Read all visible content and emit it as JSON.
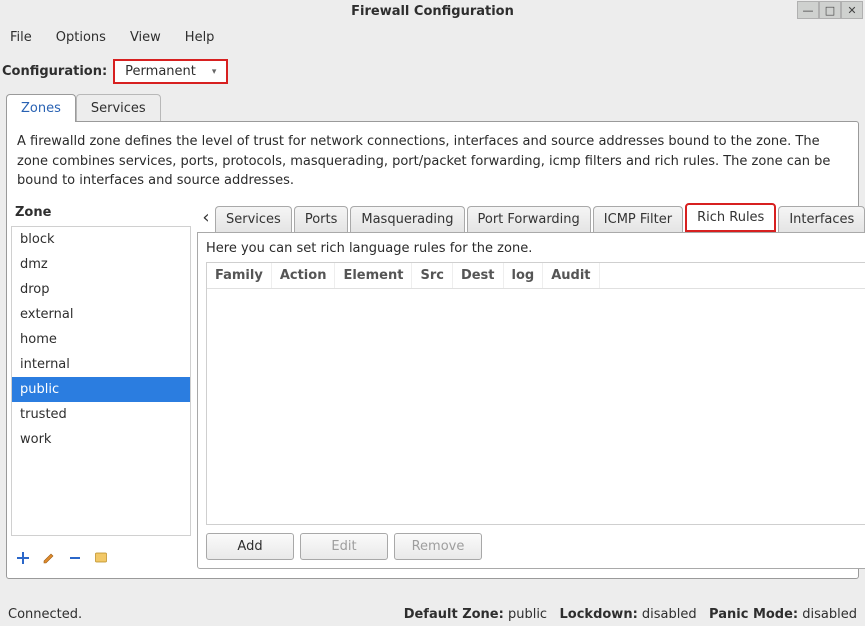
{
  "title": "Firewall Configuration",
  "menu": [
    "File",
    "Options",
    "View",
    "Help"
  ],
  "config": {
    "label": "Configuration:",
    "value": "Permanent"
  },
  "mainTabs": {
    "zones": "Zones",
    "services": "Services"
  },
  "zoneDesc": "A firewalld zone defines the level of trust for network connections, interfaces and source addresses bound to the zone. The zone combines services, ports, protocols, masquerading, port/packet forwarding, icmp filters and rich rules. The zone can be bound to interfaces and source addresses.",
  "zoneLabel": "Zone",
  "zones": [
    "block",
    "dmz",
    "drop",
    "external",
    "home",
    "internal",
    "public",
    "trusted",
    "work"
  ],
  "selectedZone": "public",
  "innerTabs": {
    "services": "Services",
    "ports": "Ports",
    "masquerading": "Masquerading",
    "portForwarding": "Port Forwarding",
    "icmpFilter": "ICMP Filter",
    "richRules": "Rich Rules",
    "interfaces": "Interfaces"
  },
  "rulesDesc": "Here you can set rich language rules for the zone.",
  "rulesColumns": {
    "family": "Family",
    "action": "Action",
    "element": "Element",
    "src": "Src",
    "dest": "Dest",
    "log": "log",
    "audit": "Audit"
  },
  "rulesButtons": {
    "add": "Add",
    "edit": "Edit",
    "remove": "Remove"
  },
  "status": {
    "connected": "Connected.",
    "defaultZoneLabel": "Default Zone:",
    "defaultZone": "public",
    "lockdownLabel": "Lockdown:",
    "lockdown": "disabled",
    "panicLabel": "Panic Mode:",
    "panic": "disabled"
  }
}
